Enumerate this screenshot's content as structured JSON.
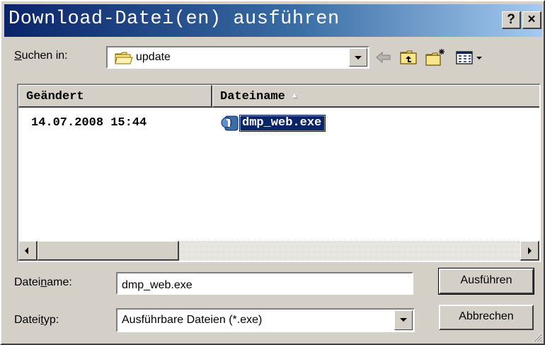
{
  "window": {
    "title": "Download-Datei(en) ausführen",
    "help_label": "?",
    "close_label": "×"
  },
  "lookin": {
    "label_prefix": "",
    "label_accel": "S",
    "label_rest": "uchen in:",
    "value": "update",
    "folder_icon": "folder-icon"
  },
  "toolbar": {
    "back_icon": "back-arrow-icon",
    "up_icon": "up-one-level-icon",
    "new_folder_icon": "new-folder-icon",
    "view_menu_icon": "view-menu-icon"
  },
  "listview": {
    "columns": [
      {
        "label": "Geändert"
      },
      {
        "label": "Dateiname",
        "sort": "ascending"
      }
    ],
    "rows": [
      {
        "changed": "14.07.2008 15:44",
        "name": "dmp_web.exe",
        "icon": "executable-file-icon",
        "selected": true
      }
    ]
  },
  "filename": {
    "label_prefix": "Datei",
    "label_accel": "n",
    "label_rest": "ame:",
    "value": "dmp_web.exe"
  },
  "filetype": {
    "label_prefix": "Datei",
    "label_accel": "t",
    "label_rest": "yp:",
    "value": "Ausführbare Dateien (*.exe)"
  },
  "buttons": {
    "run": "Ausführen",
    "cancel": "Abbrechen"
  },
  "colors": {
    "title_gradient_start": "#0a246a",
    "title_gradient_end": "#a6caf0",
    "selection": "#0a246a",
    "face": "#d4d0c8"
  }
}
